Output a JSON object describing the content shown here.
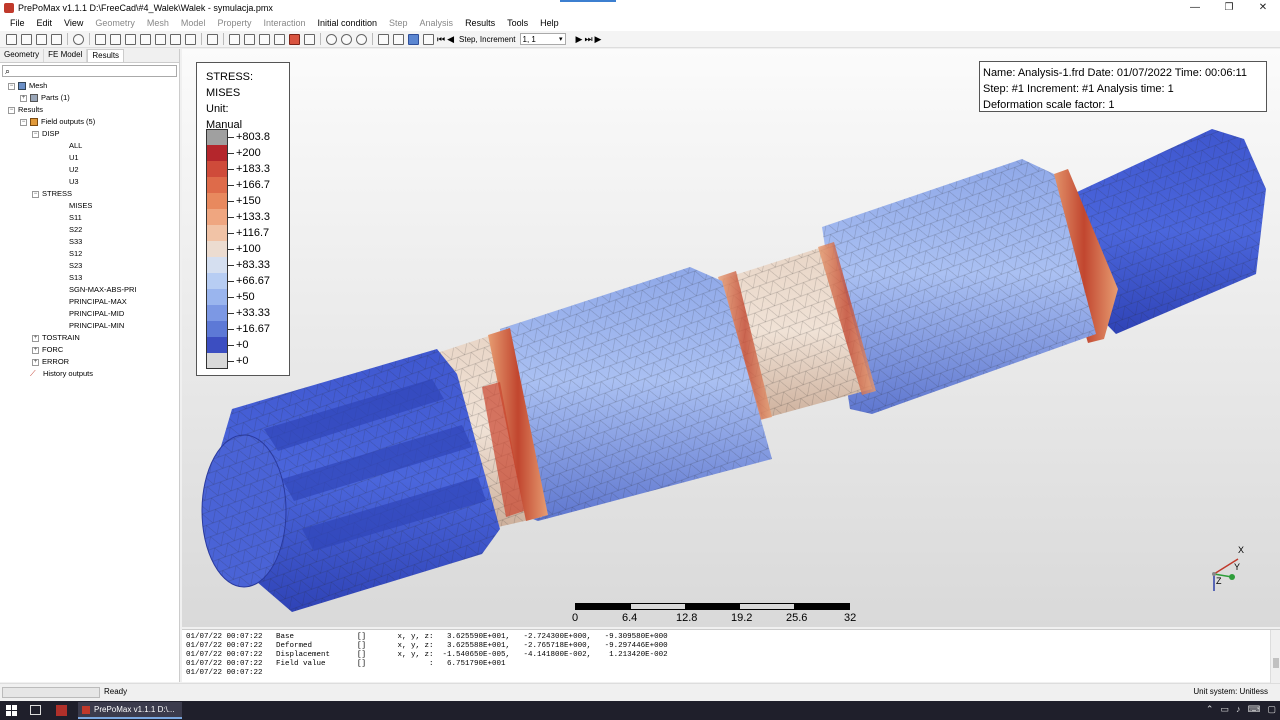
{
  "window": {
    "title": "PrePoMax v1.1.1   D:\\FreeCad\\#4_Walek\\Walek - symulacja.pmx",
    "minimize": "—",
    "maximize": "❐",
    "close": "✕"
  },
  "menu": [
    {
      "label": "File",
      "enabled": true
    },
    {
      "label": "Edit",
      "enabled": true
    },
    {
      "label": "View",
      "enabled": true
    },
    {
      "label": "Geometry",
      "enabled": false
    },
    {
      "label": "Mesh",
      "enabled": false
    },
    {
      "label": "Model",
      "enabled": false
    },
    {
      "label": "Property",
      "enabled": false
    },
    {
      "label": "Interaction",
      "enabled": false
    },
    {
      "label": "Initial condition",
      "enabled": true
    },
    {
      "label": "Step",
      "enabled": false
    },
    {
      "label": "Analysis",
      "enabled": false
    },
    {
      "label": "Results",
      "enabled": true
    },
    {
      "label": "Tools",
      "enabled": true
    },
    {
      "label": "Help",
      "enabled": true
    }
  ],
  "toolbar": {
    "step_label": "Step, Increment",
    "step_value": "1, 1"
  },
  "panel": {
    "tabs": [
      "Geometry",
      "FE Model",
      "Results"
    ],
    "active_tab": "Results",
    "search_placeholder": ""
  },
  "tree": {
    "mesh": "Mesh",
    "parts": "Parts (1)",
    "results": "Results",
    "field_outputs": "Field outputs (5)",
    "disp": "DISP",
    "disp_items": [
      "ALL",
      "U1",
      "U2",
      "U3"
    ],
    "stress": "STRESS",
    "stress_items": [
      "MISES",
      "S11",
      "S22",
      "S33",
      "S12",
      "S23",
      "S13",
      "SGN-MAX-ABS-PRI",
      "PRINCIPAL-MAX",
      "PRINCIPAL-MID",
      "PRINCIPAL-MIN"
    ],
    "tostrain": "TOSTRAIN",
    "forc": "FORC",
    "error": "ERROR",
    "history_outputs": "History outputs"
  },
  "legend": {
    "title": "STRESS: MISES",
    "unit": "Unit:",
    "mode": "Manual",
    "entries": [
      {
        "value": "+803.8",
        "color": "#a0a0a0"
      },
      {
        "value": "+200",
        "color": "#b4262c"
      },
      {
        "value": "+183.3",
        "color": "#cf4b3a"
      },
      {
        "value": "+166.7",
        "color": "#de6b4a"
      },
      {
        "value": "+150",
        "color": "#e8895e"
      },
      {
        "value": "+133.3",
        "color": "#efa680"
      },
      {
        "value": "+116.7",
        "color": "#f1c3a6"
      },
      {
        "value": "+100",
        "color": "#ecdcd0"
      },
      {
        "value": "+83.33",
        "color": "#d5dff0"
      },
      {
        "value": "+66.67",
        "color": "#b7cdf3"
      },
      {
        "value": "+50",
        "color": "#9ab5ee"
      },
      {
        "value": "+33.33",
        "color": "#7c98e4"
      },
      {
        "value": "+16.67",
        "color": "#5d79d6"
      },
      {
        "value": "+0",
        "color": "#3c4ec1"
      },
      {
        "value": "+0",
        "color": "#d9d9d9"
      }
    ]
  },
  "info": {
    "line1": "Name: Analysis-1.frd   Date: 01/07/2022   Time: 00:06:11",
    "line2": "Step: #1   Increment: #1   Analysis time: 1",
    "line3": "Deformation scale factor: 1"
  },
  "scale_bar": {
    "labels": [
      "0",
      "6.4",
      "12.8",
      "19.2",
      "25.6",
      "32"
    ]
  },
  "triad": {
    "x": "X",
    "y": "Y",
    "z": "Z"
  },
  "console": [
    "01/07/22 00:07:22   Base              []       x, y, z:   3.625590E+001,   -2.724300E+000,   -9.309580E+000",
    "01/07/22 00:07:22   Deformed          []       x, y, z:   3.625588E+001,   -2.765718E+000,   -9.297446E+000",
    "01/07/22 00:07:22   Displacement      []       x, y, z:  -1.540650E-005,   -4.141800E-002,    1.213420E-002",
    "01/07/22 00:07:22   Field value       []              :   6.751790E+001",
    "01/07/22 00:07:22"
  ],
  "status": {
    "text": "Ready",
    "unit_system": "Unit system: Unitless"
  },
  "taskbar": {
    "task_label": "PrePoMax v1.1.1  D:\\..."
  }
}
